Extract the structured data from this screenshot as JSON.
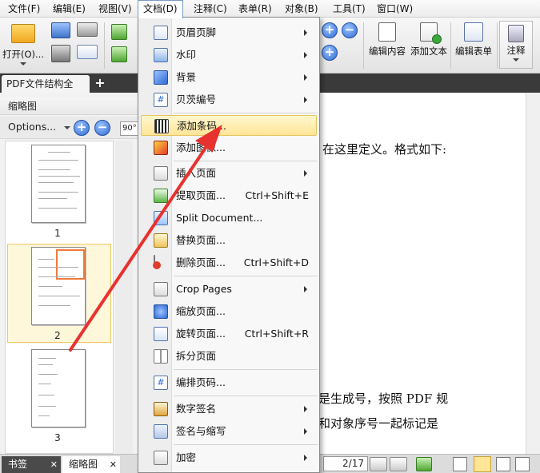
{
  "menubar": {
    "items": [
      {
        "label": "文件(F)"
      },
      {
        "label": "编辑(E)"
      },
      {
        "label": "视图(V)"
      },
      {
        "label": "文档(D)"
      },
      {
        "label": "注释(C)"
      },
      {
        "label": "表单(R)"
      },
      {
        "label": "对象(B)"
      },
      {
        "label": "工具(T)"
      },
      {
        "label": "窗口(W)"
      }
    ]
  },
  "ribbon": {
    "open_label": "打开(O)...",
    "edit_content_label": "编辑内容",
    "add_text_label": "添加文本",
    "edit_form_label": "编辑表单",
    "annotate_label": "注释"
  },
  "tab": {
    "doc_title": "PDF文件结构全",
    "new_tab": "+"
  },
  "leftpanel": {
    "title": "缩略图",
    "options_label": "Options...",
    "zoom_in": "+",
    "zoom_out": "−",
    "rotate": "90°",
    "thumbnails": [
      {
        "number": "1"
      },
      {
        "number": "2"
      },
      {
        "number": "3"
      }
    ]
  },
  "document": {
    "line1": "在这里定义。格式如下:",
    "line2": "是生成号，按照 PDF 规",
    "line3": "和对象序号一起标记是"
  },
  "menu": {
    "items": [
      {
        "label": "页眉页脚",
        "shortcut": "",
        "submenu": true
      },
      {
        "label": "水印",
        "shortcut": "",
        "submenu": true
      },
      {
        "label": "背景",
        "shortcut": "",
        "submenu": true
      },
      {
        "label": "贝茨编号",
        "shortcut": "",
        "submenu": true
      },
      {
        "label": "添加条码...",
        "shortcut": "",
        "submenu": false
      },
      {
        "label": "添加图像...",
        "shortcut": "",
        "submenu": false
      },
      {
        "label": "插入页面",
        "shortcut": "",
        "submenu": true
      },
      {
        "label": "提取页面...",
        "shortcut": "Ctrl+Shift+E",
        "submenu": false
      },
      {
        "label": "Split Document...",
        "shortcut": "",
        "submenu": false
      },
      {
        "label": "替换页面...",
        "shortcut": "",
        "submenu": false
      },
      {
        "label": "删除页面...",
        "shortcut": "Ctrl+Shift+D",
        "submenu": false
      },
      {
        "label": "Crop Pages",
        "shortcut": "",
        "submenu": true
      },
      {
        "label": "缩放页面...",
        "shortcut": "",
        "submenu": false
      },
      {
        "label": "旋转页面...",
        "shortcut": "Ctrl+Shift+R",
        "submenu": false
      },
      {
        "label": "拆分页面",
        "shortcut": "",
        "submenu": false
      },
      {
        "label": "编排页码...",
        "shortcut": "",
        "submenu": false
      },
      {
        "label": "数字签名",
        "shortcut": "",
        "submenu": true
      },
      {
        "label": "签名与缩写",
        "shortcut": "",
        "submenu": true
      },
      {
        "label": "加密",
        "shortcut": "",
        "submenu": true
      }
    ],
    "hovered": "添加条码..."
  },
  "bottombar": {
    "bookmarks_tab": "书签",
    "thumbnails_tab": "缩略图",
    "page_value": "2/17"
  },
  "colors": {
    "accent_blue": "#2d6ad3",
    "hover_yellow": "#ffe596",
    "arrow_red": "#e8322f"
  }
}
